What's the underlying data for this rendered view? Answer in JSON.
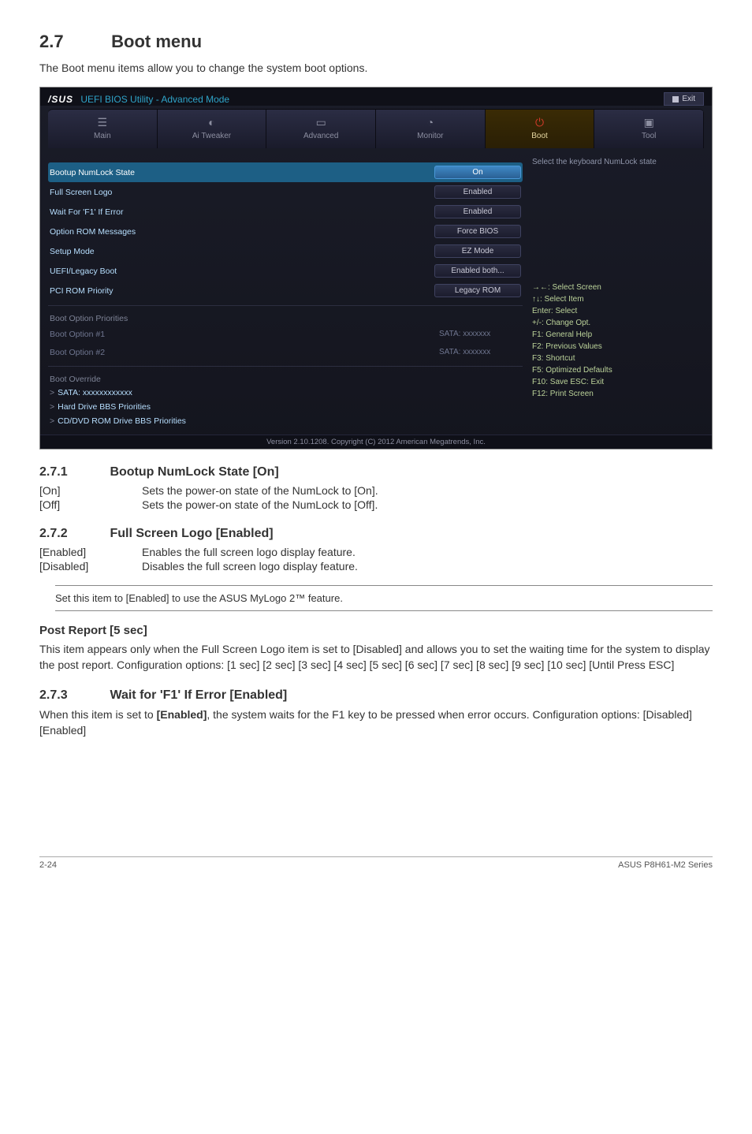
{
  "section": {
    "num": "2.7",
    "title": "Boot menu",
    "intro": "The Boot menu items allow you to change the system boot options."
  },
  "bios": {
    "titleBrand": "/SUS",
    "title": "UEFI BIOS Utility - Advanced Mode",
    "exit": "Exit",
    "nav": {
      "main": "Main",
      "ai": "Ai  Tweaker",
      "adv": "Advanced",
      "mon": "Monitor",
      "boot": "Boot",
      "tool": "Tool"
    },
    "rows": {
      "numlock": {
        "label": "Bootup NumLock State",
        "val": "On"
      },
      "logo": {
        "label": "Full Screen Logo",
        "val": "Enabled"
      },
      "f1": {
        "label": "Wait For 'F1' If Error",
        "val": "Enabled"
      },
      "oprom": {
        "label": "Option ROM Messages",
        "val": "Force BIOS"
      },
      "setup": {
        "label": "Setup Mode",
        "val": "EZ Mode"
      },
      "uefi": {
        "label": "UEFI/Legacy Boot",
        "val": "Enabled both..."
      },
      "pci": {
        "label": "PCI ROM Priority",
        "val": "Legacy ROM"
      }
    },
    "groupPriorities": "Boot Option Priorities",
    "bo1": {
      "label": "Boot Option #1",
      "val": "SATA: xxxxxxx"
    },
    "bo2": {
      "label": "Boot Option #2",
      "val": "SATA: xxxxxxx"
    },
    "groupOverride": "Boot Override",
    "ovr1": "SATA: xxxxxxxxxxxx",
    "ovr2": "Hard Drive BBS Priorities",
    "ovr3": "CD/DVD ROM Drive BBS Priorities",
    "helpTop": "Select the keyboard NumLock state",
    "keys": {
      "k1": "→←:  Select  Screen",
      "k2": "↑↓:  Select Item",
      "k3": "Enter:  Select",
      "k4": "+/-:  Change Opt.",
      "k5": "F1:  General Help",
      "k6": "F2:  Previous Values",
      "k7": "F3:  Shortcut",
      "k8": "F5:  Optimized Defaults",
      "k9": "F10:  Save    ESC:  Exit",
      "k10": "F12:  Print Screen"
    },
    "footer": "Version  2.10.1208.   Copyright  (C)  2012 American  Megatrends,  Inc."
  },
  "s271": {
    "num": "2.7.1",
    "title": "Bootup NumLock State [On]",
    "on": {
      "k": "[On]",
      "v": "Sets the power-on state of the NumLock to [On]."
    },
    "off": {
      "k": "[Off]",
      "v": "Sets the power-on state of the NumLock to [Off]."
    }
  },
  "s272": {
    "num": "2.7.2",
    "title": "Full Screen Logo [Enabled]",
    "en": {
      "k": "[Enabled]",
      "v": "Enables the full screen logo display feature."
    },
    "dis": {
      "k": "[Disabled]",
      "v": "Disables the full screen logo display feature."
    },
    "note": "Set this item to [Enabled] to use the ASUS MyLogo 2™ feature."
  },
  "post": {
    "title": "Post Report [5 sec]",
    "body": "This item appears only when the Full Screen Logo item is set to [Disabled] and allows you to set the waiting time for the system to display the post report. Configuration options: [1 sec] [2 sec] [3 sec] [4 sec] [5 sec] [6 sec] [7 sec] [8 sec] [9 sec] [10 sec] [Until Press ESC]"
  },
  "s273": {
    "num": "2.7.3",
    "title": "Wait for 'F1' If Error [Enabled]",
    "body1": "When this item is set to ",
    "bold": "[Enabled]",
    "body2": ", the system waits for the F1 key to be pressed when error occurs. Configuration options: [Disabled] [Enabled]"
  },
  "foot": {
    "left": "2-24",
    "right": "ASUS P8H61-M2 Series"
  }
}
